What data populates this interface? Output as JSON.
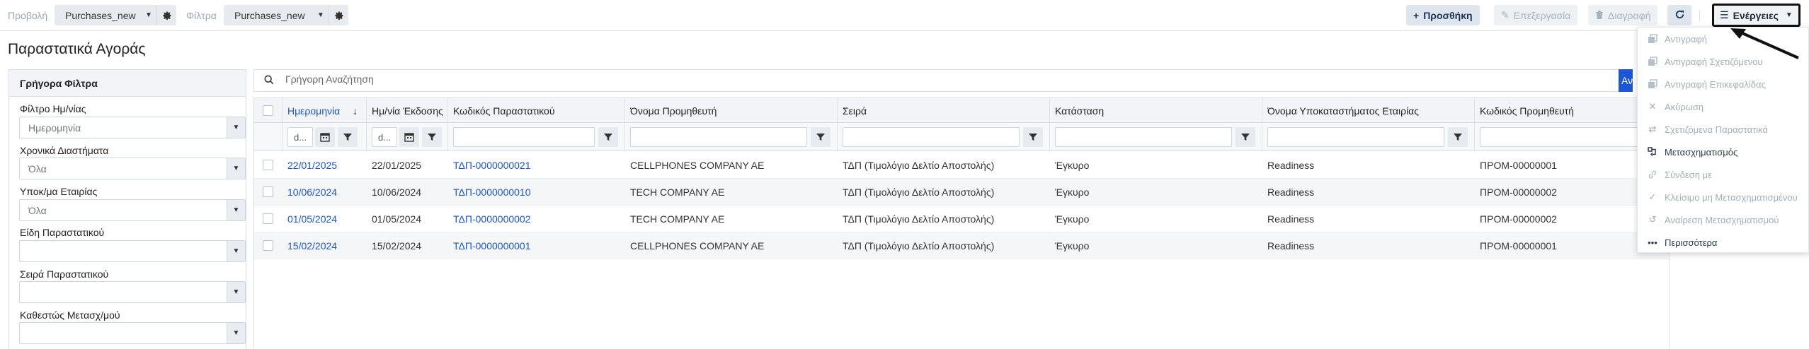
{
  "toolbar": {
    "view_label": "Προβολή",
    "view_value": "Purchases_new",
    "filter_label": "Φίλτρα",
    "filter_value": "Purchases_new",
    "add_label": "Προσθήκη",
    "edit_label": "Επεξεργασία",
    "delete_label": "Διαγραφή",
    "actions_label": "Ενέργειες"
  },
  "page": {
    "title": "Παραστατικά Αγοράς"
  },
  "quick_filters": {
    "header": "Γρήγορα Φίλτρα",
    "items": [
      {
        "label": "Φίλτρο Ημ/νίας",
        "value": "Ημερομηνία"
      },
      {
        "label": "Χρονικά Διαστήματα",
        "value": "Όλα"
      },
      {
        "label": "Υποκ/μα Εταιρίας",
        "value": "Όλα"
      },
      {
        "label": "Είδη Παραστατικού",
        "value": ""
      },
      {
        "label": "Σειρά Παραστατικού",
        "value": ""
      },
      {
        "label": "Καθεστώς Μετασχ/μού",
        "value": ""
      }
    ]
  },
  "search": {
    "placeholder": "Γρήγορη Αναζήτηση",
    "button_label": "Αναζήτηση"
  },
  "grid": {
    "columns": [
      "Ημερομηνία",
      "Ημ/νία Έκδοσης",
      "Κωδικός Παραστατικού",
      "Όνομα Προμηθευτή",
      "Σειρά",
      "Κατάσταση",
      "Όνομα Υποκαταστήματος Εταιρίας",
      "Κωδικός Προμηθευτή"
    ],
    "date_filter_placeholder": "d...",
    "rows": [
      {
        "date": "22/01/2025",
        "issue_date": "22/01/2025",
        "code": "ΤΔΠ-0000000021",
        "supplier": "CELLPHONES COMPANY AE",
        "series": "ΤΔΠ (Τιμολόγιο Δελτίο Αποστολής)",
        "status": "Έγκυρο",
        "branch": "Readiness",
        "supplier_code": "ΠΡΟΜ-00000001"
      },
      {
        "date": "10/06/2024",
        "issue_date": "10/06/2024",
        "code": "ΤΔΠ-0000000010",
        "supplier": "TECH COMPANY AE",
        "series": "ΤΔΠ (Τιμολόγιο Δελτίο Αποστολής)",
        "status": "Έγκυρο",
        "branch": "Readiness",
        "supplier_code": "ΠΡΟΜ-00000002"
      },
      {
        "date": "01/05/2024",
        "issue_date": "01/05/2024",
        "code": "ΤΔΠ-0000000002",
        "supplier": "TECH COMPANY AE",
        "series": "ΤΔΠ (Τιμολόγιο Δελτίο Αποστολής)",
        "status": "Έγκυρο",
        "branch": "Readiness",
        "supplier_code": "ΠΡΟΜ-00000002"
      },
      {
        "date": "15/02/2024",
        "issue_date": "15/02/2024",
        "code": "ΤΔΠ-0000000001",
        "supplier": "CELLPHONES COMPANY AE",
        "series": "ΤΔΠ (Τιμολόγιο Δελτίο Αποστολής)",
        "status": "Έγκυρο",
        "branch": "Readiness",
        "supplier_code": "ΠΡΟΜ-00000001"
      }
    ]
  },
  "actions_menu": {
    "items": [
      {
        "label": "Αντιγραφή",
        "icon": "copy-icon",
        "enabled": false
      },
      {
        "label": "Αντιγραφή Σχετιζόμενου",
        "icon": "copy-icon",
        "enabled": false
      },
      {
        "label": "Αντιγραφή Επικεφαλίδας",
        "icon": "copy-icon",
        "enabled": false
      },
      {
        "label": "Ακύρωση",
        "icon": "close-icon",
        "enabled": false
      },
      {
        "label": "Σχετιζόμενα Παραστατικά",
        "icon": "swap-icon",
        "enabled": false
      },
      {
        "label": "Μετασχηματισμός",
        "icon": "transform-icon",
        "enabled": true
      },
      {
        "label": "Σύνδεση με",
        "icon": "link-icon",
        "enabled": false
      },
      {
        "label": "Κλείσιμο μη Μετασχηματισμένου",
        "icon": "check-icon",
        "enabled": false
      },
      {
        "label": "Αναίρεση Μετασχηματισμού",
        "icon": "undo-icon",
        "enabled": false
      },
      {
        "label": "Περισσότερα",
        "icon": "more-icon",
        "enabled": true
      }
    ]
  },
  "colors": {
    "accent": "#1a56d6",
    "header_bg": "#f2f4f7",
    "disabled_text": "#a3adb9"
  }
}
